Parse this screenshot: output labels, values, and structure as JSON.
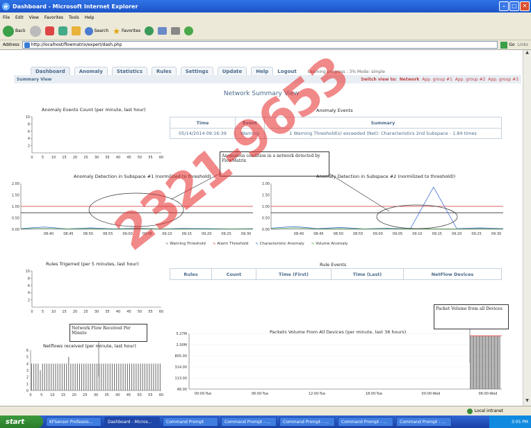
{
  "window": {
    "title": "Dashboard - Microsoft Internet Explorer"
  },
  "menu": [
    "File",
    "Edit",
    "View",
    "Favorites",
    "Tools",
    "Help"
  ],
  "toolbar": {
    "back": "Back",
    "search": "Search",
    "favorites": "Favorites"
  },
  "address": {
    "label": "Address",
    "url": "http://localhost/flowmatrix/expert/dash.php",
    "go": "Go",
    "links": "Links"
  },
  "tabs": [
    "Dashboard",
    "Anomaly",
    "Statistics",
    "Rules",
    "Settings",
    "Update",
    "Help"
  ],
  "logout": "Logout",
  "progress": "Learning progress : 3%  Mode: simple",
  "summary_view": "Summary View",
  "switch_label": "Switch view to:",
  "switch_items": [
    "Network",
    "App. group #1",
    "App. group #2",
    "App. group #3"
  ],
  "page_title": "Network Summary View",
  "anomaly_events_count": {
    "title": "Anomaly Events Count (per minute, last hour)"
  },
  "anomaly_events": {
    "title": "Anomaly Events",
    "headers": [
      "Time",
      "Event",
      "Summary"
    ],
    "row": {
      "time": "05/14/2014   09:16:39",
      "event": "Warning",
      "summary": "1 Warning Threshold(s) exceeded (Net): Characteristics 2nd Subspace - 1.84 times"
    }
  },
  "callout1": "Anomalous condition in a network detected by FlowMatrix",
  "subspace1": {
    "title": "Anomaly Detection in Subspace #1 (normilized to threshold)"
  },
  "subspace2": {
    "title": "Anomaly Detection in Subspace #2 (normilized to threshold))"
  },
  "legend": [
    "Warning Threshold",
    "Alarm Threshold",
    "Characteristic Anomaly",
    "Volume Anomaly"
  ],
  "rules_triggered": {
    "title": "Rules Trigerred (per 5 minutes, last hour)"
  },
  "rule_events": {
    "title": "Rule Events",
    "headers": [
      "Rules",
      "Count",
      "Time (First)",
      "Time (Last)",
      "NetFlow Devices"
    ]
  },
  "callout2": "Network Flow Received Per Minute",
  "callout3": "Packet Volume from all Devices",
  "netflows": {
    "title": "Netflows received (per minute, last hour)"
  },
  "packets": {
    "title": "Packets Volume From All Devices (per minute, last 36 hours)"
  },
  "status": {
    "zone": "Local intranet"
  },
  "taskbar": {
    "start": "start",
    "tasks": [
      "KFSensor Professio...",
      "Dashboard - Micros...",
      "Command Prompt",
      "Command Prompt - ...",
      "Command Prompt - ...",
      "Command Prompt - ...",
      "Command Prompt - ..."
    ],
    "clock": "3:05 PM"
  },
  "watermark": "2321-9653",
  "chart_data": [
    {
      "type": "line",
      "title": "Anomaly Events Count (per minute, last hour)",
      "x_ticks": [
        "0",
        "5",
        "10",
        "15",
        "20",
        "25",
        "30",
        "35",
        "40",
        "45",
        "50",
        "55",
        "60"
      ],
      "y_ticks": [
        "2",
        "4",
        "6",
        "8",
        "10"
      ],
      "ylim": [
        0,
        10
      ],
      "series": []
    },
    {
      "type": "line",
      "title": "Anomaly Detection in Subspace #1 (normilized to threshold)",
      "x_ticks": [
        "08:40",
        "08:45",
        "08:50",
        "08:55",
        "09:00",
        "09:05",
        "09:10",
        "09:15",
        "09:20",
        "09:25",
        "09:30"
      ],
      "y_ticks": [
        "0.00",
        "0.50",
        "1.00",
        "1.50",
        "2.00"
      ],
      "ylim": [
        0,
        2
      ],
      "series": [
        {
          "name": "Warning Threshold",
          "values": [
            0.72,
            0.72,
            0.72,
            0.72,
            0.72,
            0.72,
            0.72,
            0.72,
            0.72,
            0.72,
            0.72
          ]
        },
        {
          "name": "Alarm Threshold",
          "values": [
            1,
            1,
            1,
            1,
            1,
            1,
            1,
            1,
            1,
            1,
            1
          ]
        },
        {
          "name": "Characteristic Anomaly",
          "values": [
            0.03,
            0.1,
            0.02,
            0.06,
            0.02,
            0.05,
            0.02,
            0.04,
            0.03,
            0.02,
            0.03
          ]
        },
        {
          "name": "Volume Anomaly",
          "values": [
            0.02,
            0.05,
            0.02,
            0.03,
            0.01,
            0.03,
            0.02,
            0.02,
            0.01,
            0.02,
            0.02
          ]
        }
      ]
    },
    {
      "type": "line",
      "title": "Anomaly Detection in Subspace #2 (normilized to threshold))",
      "x_ticks": [
        "08:40",
        "08:45",
        "08:50",
        "08:55",
        "09:00",
        "09:05",
        "09:10",
        "09:15",
        "09:20",
        "09:25",
        "09:30"
      ],
      "y_ticks": [
        "0.00",
        "0.50",
        "1.00",
        "1.50",
        "2.00"
      ],
      "ylim": [
        0,
        2
      ],
      "series": [
        {
          "name": "Warning Threshold",
          "values": [
            0.72,
            0.72,
            0.72,
            0.72,
            0.72,
            0.72,
            0.72,
            0.72,
            0.72,
            0.72,
            0.72
          ]
        },
        {
          "name": "Alarm Threshold",
          "values": [
            1,
            1,
            1,
            1,
            1,
            1,
            1,
            1,
            1,
            1,
            1
          ]
        },
        {
          "name": "Characteristic Anomaly",
          "values": [
            0.05,
            0.12,
            0.03,
            0.08,
            0.02,
            0.05,
            0.02,
            1.84,
            0.03,
            0.06,
            0.03
          ]
        },
        {
          "name": "Volume Anomaly",
          "values": [
            0.02,
            0.06,
            0.02,
            0.03,
            0.02,
            0.03,
            0.02,
            0.02,
            0.02,
            0.03,
            0.02
          ]
        }
      ]
    },
    {
      "type": "line",
      "title": "Rules Trigerred (per 5 minutes, last hour)",
      "x_ticks": [
        "0",
        "5",
        "10",
        "15",
        "20",
        "25",
        "30",
        "35",
        "40",
        "45",
        "50",
        "55",
        "60"
      ],
      "y_ticks": [
        "2",
        "4",
        "6",
        "8",
        "10"
      ],
      "ylim": [
        0,
        10
      ],
      "series": []
    },
    {
      "type": "bar",
      "title": "Netflows received (per minute, last hour)",
      "x_ticks": [
        "0",
        "5",
        "10",
        "15",
        "20",
        "25",
        "30",
        "35",
        "40",
        "45",
        "50",
        "55",
        "60"
      ],
      "y_ticks": [
        "0",
        "1",
        "2",
        "3",
        "4",
        "5",
        "6"
      ],
      "ylim": [
        0,
        6
      ],
      "values": [
        4,
        4,
        4,
        4,
        3,
        4,
        4,
        4,
        4,
        4,
        4,
        4,
        4,
        4,
        4,
        4,
        4,
        5,
        4,
        4,
        4,
        4,
        4,
        4,
        4,
        4,
        4,
        4,
        4,
        4,
        4,
        4,
        4,
        4,
        4,
        4,
        4,
        4,
        4,
        4,
        4,
        4,
        4,
        4,
        4,
        4,
        4,
        4,
        4,
        4,
        4,
        4,
        4,
        4,
        4,
        4,
        4,
        4,
        4,
        4
      ]
    },
    {
      "type": "bar",
      "title": "Packets Volume From All Devices (per minute, last 36 hours)",
      "x_ticks": [
        "00:00-Tue",
        "06:00-Tue",
        "12:00-Tue",
        "18:00-Tue",
        "00:00-Wed",
        "06:00-Wed"
      ],
      "y_ticks": [
        "48.00",
        "113.00",
        "314.00",
        "805.00",
        "2.00M",
        "5.27M"
      ],
      "values_level_index": 4.8
    }
  ]
}
